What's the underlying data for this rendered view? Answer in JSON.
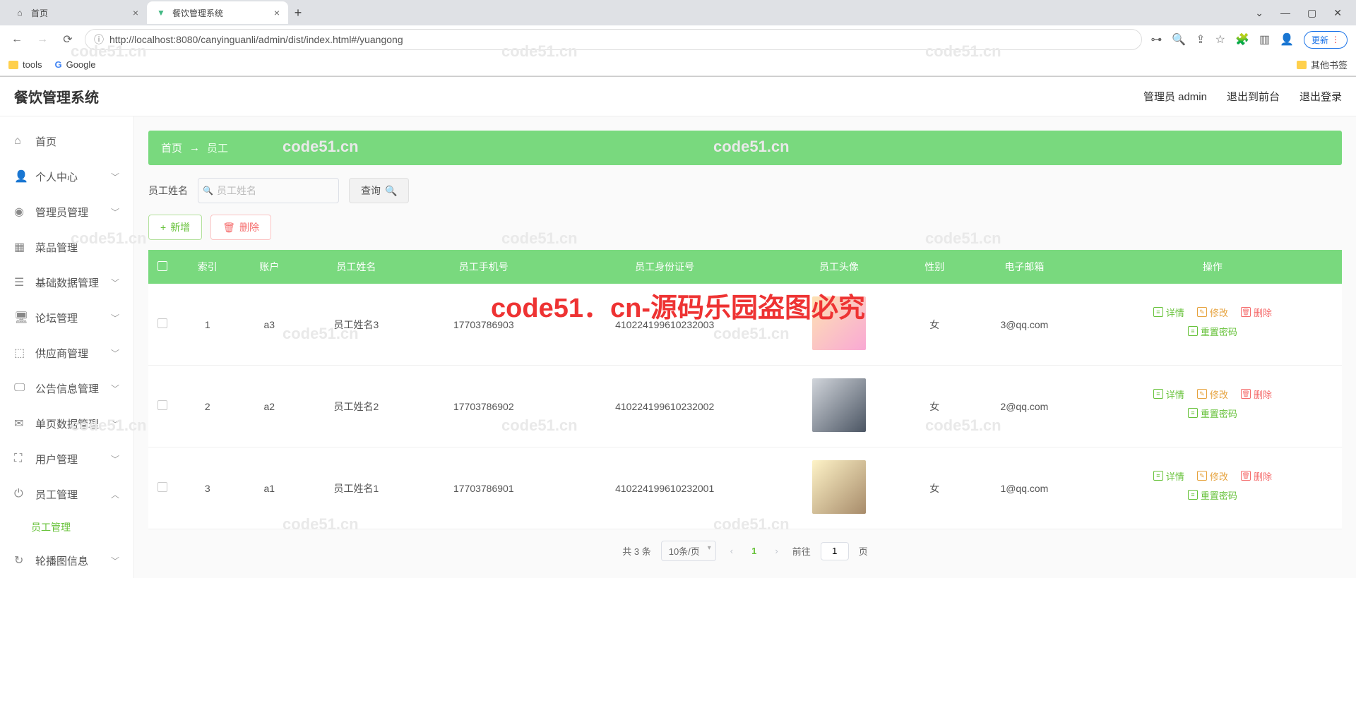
{
  "browser": {
    "tabs": [
      {
        "title": "首页",
        "active": false
      },
      {
        "title": "餐饮管理系统",
        "active": true
      }
    ],
    "url": "http://localhost:8080/canyinguanli/admin/dist/index.html#/yuangong",
    "update_btn": "更新",
    "bookmarks": {
      "tools": "tools",
      "google": "Google",
      "other": "其他书签"
    }
  },
  "app": {
    "title": "餐饮管理系统",
    "admin_label": "管理员 admin",
    "logout_front": "退出到前台",
    "logout": "退出登录"
  },
  "sidebar": {
    "items": [
      {
        "label": "首页"
      },
      {
        "label": "个人中心",
        "expandable": true
      },
      {
        "label": "管理员管理",
        "expandable": true
      },
      {
        "label": "菜品管理"
      },
      {
        "label": "基础数据管理",
        "expandable": true
      },
      {
        "label": "论坛管理",
        "expandable": true
      },
      {
        "label": "供应商管理",
        "expandable": true
      },
      {
        "label": "公告信息管理",
        "expandable": true
      },
      {
        "label": "单页数据管理",
        "expandable": true
      },
      {
        "label": "用户管理",
        "expandable": true
      },
      {
        "label": "员工管理",
        "expandable": true,
        "expanded": true,
        "sub": "员工管理"
      },
      {
        "label": "轮播图信息",
        "expandable": true
      }
    ]
  },
  "breadcrumb": {
    "home": "首页",
    "sep": "→",
    "current": "员工"
  },
  "search": {
    "label": "员工姓名",
    "placeholder": "员工姓名",
    "query_btn": "查询"
  },
  "actions": {
    "add": "新增",
    "delete": "删除"
  },
  "table": {
    "headers": [
      "",
      "索引",
      "账户",
      "员工姓名",
      "员工手机号",
      "员工身份证号",
      "员工头像",
      "性别",
      "电子邮箱",
      "操作"
    ],
    "rows": [
      {
        "index": "1",
        "account": "a3",
        "name": "员工姓名3",
        "phone": "17703786903",
        "idcard": "410224199610232003",
        "gender": "女",
        "email": "3@qq.com",
        "avatar": "a1"
      },
      {
        "index": "2",
        "account": "a2",
        "name": "员工姓名2",
        "phone": "17703786902",
        "idcard": "410224199610232002",
        "gender": "女",
        "email": "2@qq.com",
        "avatar": "a2"
      },
      {
        "index": "3",
        "account": "a1",
        "name": "员工姓名1",
        "phone": "17703786901",
        "idcard": "410224199610232001",
        "gender": "女",
        "email": "1@qq.com",
        "avatar": "a3"
      }
    ],
    "ops": {
      "detail": "详情",
      "edit": "修改",
      "delete": "删除",
      "reset": "重置密码"
    }
  },
  "pagination": {
    "total": "共 3 条",
    "page_size": "10条/页",
    "current_page": "1",
    "goto_prefix": "前往",
    "goto_value": "1",
    "goto_suffix": "页"
  },
  "watermark": "code51.cn",
  "watermark_red": "code51．cn-源码乐园盗图必究"
}
